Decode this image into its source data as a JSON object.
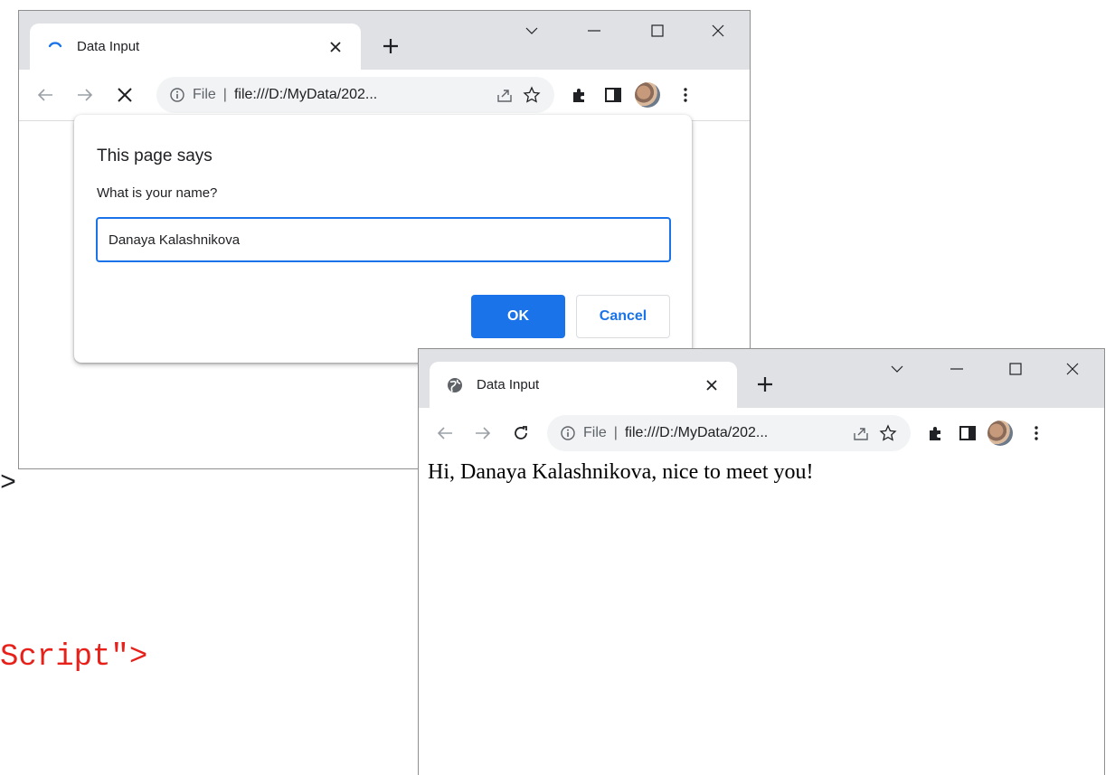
{
  "background_code": {
    "fragment_1": ">",
    "fragment_2": "Script\">"
  },
  "window1": {
    "tab_title": "Data Input",
    "scheme_label": "File",
    "separator": "|",
    "url": "file:///D:/MyData/202...",
    "dialog": {
      "title": "This page says",
      "message": "What is your name?",
      "input_value": "Danaya Kalashnikova",
      "ok_label": "OK",
      "cancel_label": "Cancel"
    }
  },
  "window2": {
    "tab_title": "Data Input",
    "scheme_label": "File",
    "separator": "|",
    "url": "file:///D:/MyData/202...",
    "page_text": "Hi, Danaya Kalashnikova, nice to meet you!"
  },
  "colors": {
    "accent": "#1a73e8",
    "tabbar": "#dfe1e5",
    "code_red": "#e8201a"
  }
}
